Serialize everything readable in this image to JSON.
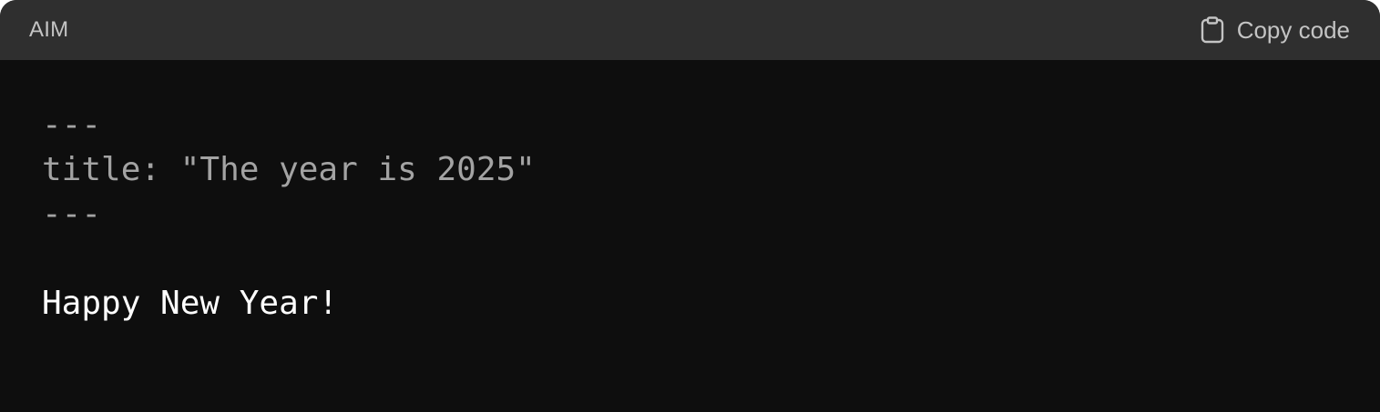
{
  "header": {
    "language": "AIM",
    "copy_label": "Copy code",
    "copy_icon": "clipboard-icon"
  },
  "code": {
    "lines": [
      "---",
      "title: \"The year is 2025\"",
      "---",
      "",
      "Happy New Year!"
    ]
  },
  "colors": {
    "header_bg": "#2f2f2f",
    "code_bg": "#0e0e0e",
    "frontmatter_text": "#a3a3a3",
    "body_text": "#ffffff"
  }
}
